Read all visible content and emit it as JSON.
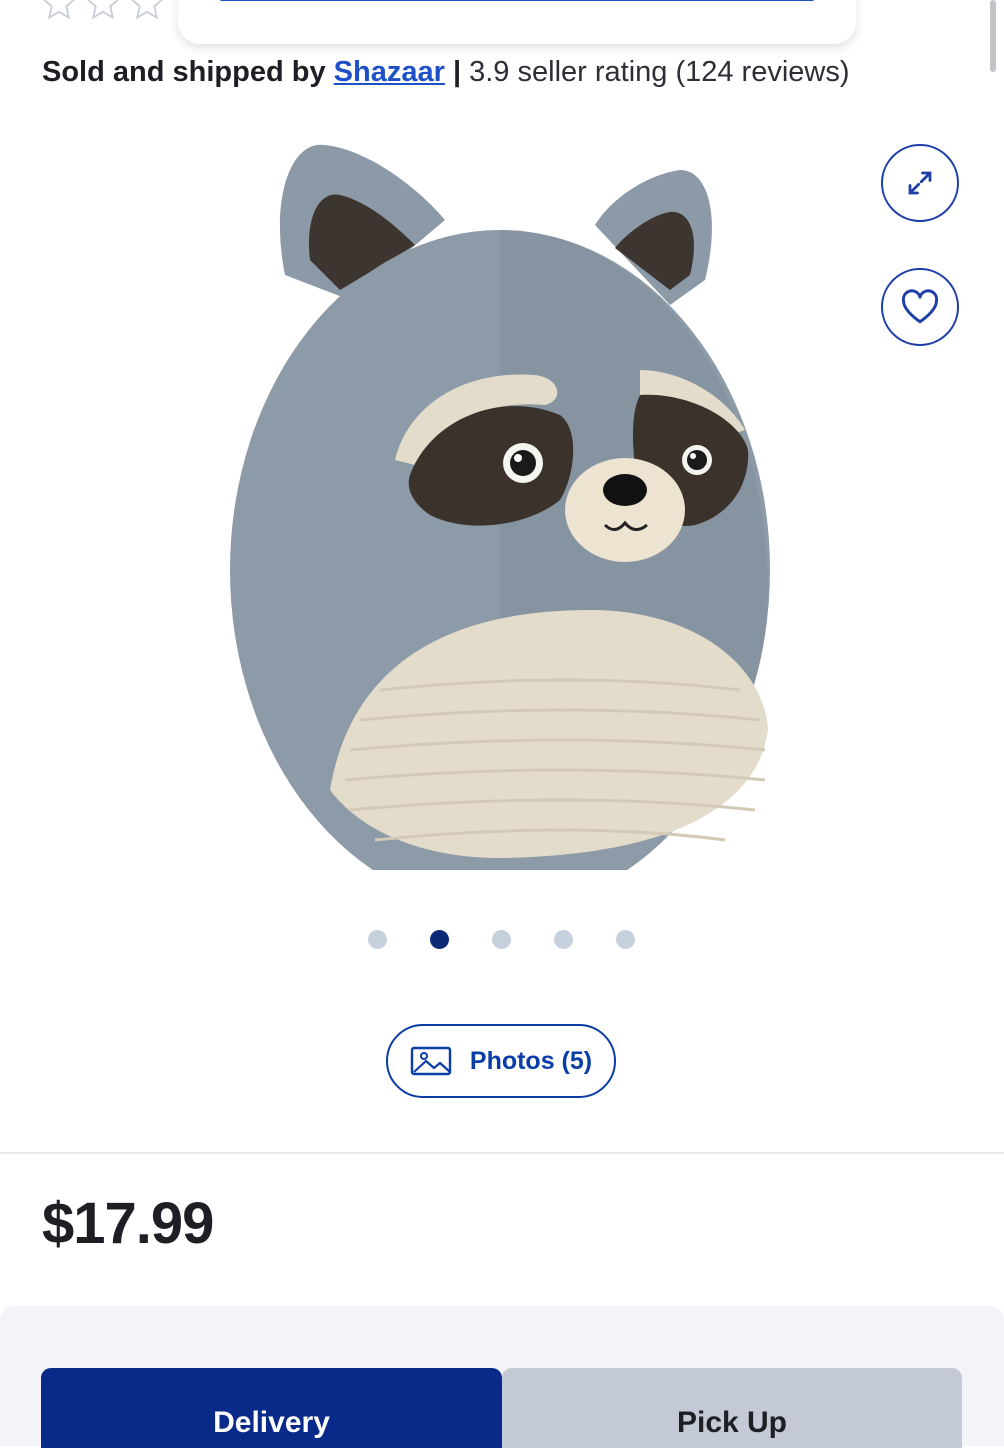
{
  "rating": {
    "stars_filled": 0,
    "stars_total": 3
  },
  "seller": {
    "prefix": "Sold and shipped by",
    "name": "Shazaar",
    "separator": "|",
    "rating_text": "3.9 seller rating (124 reviews)"
  },
  "gallery": {
    "expand_icon": "expand-icon",
    "favorite_icon": "heart-icon",
    "dots_total": 5,
    "active_index": 1,
    "photos_label": "Photos (5)"
  },
  "price": "$17.99",
  "fulfillment": {
    "tabs": [
      {
        "label": "Delivery",
        "active": true
      },
      {
        "label": "Pick Up",
        "active": false
      }
    ]
  },
  "colors": {
    "accent": "#1e50c8",
    "active_tab": "#0a2a8a",
    "inactive_tab": "#c3cad6"
  }
}
